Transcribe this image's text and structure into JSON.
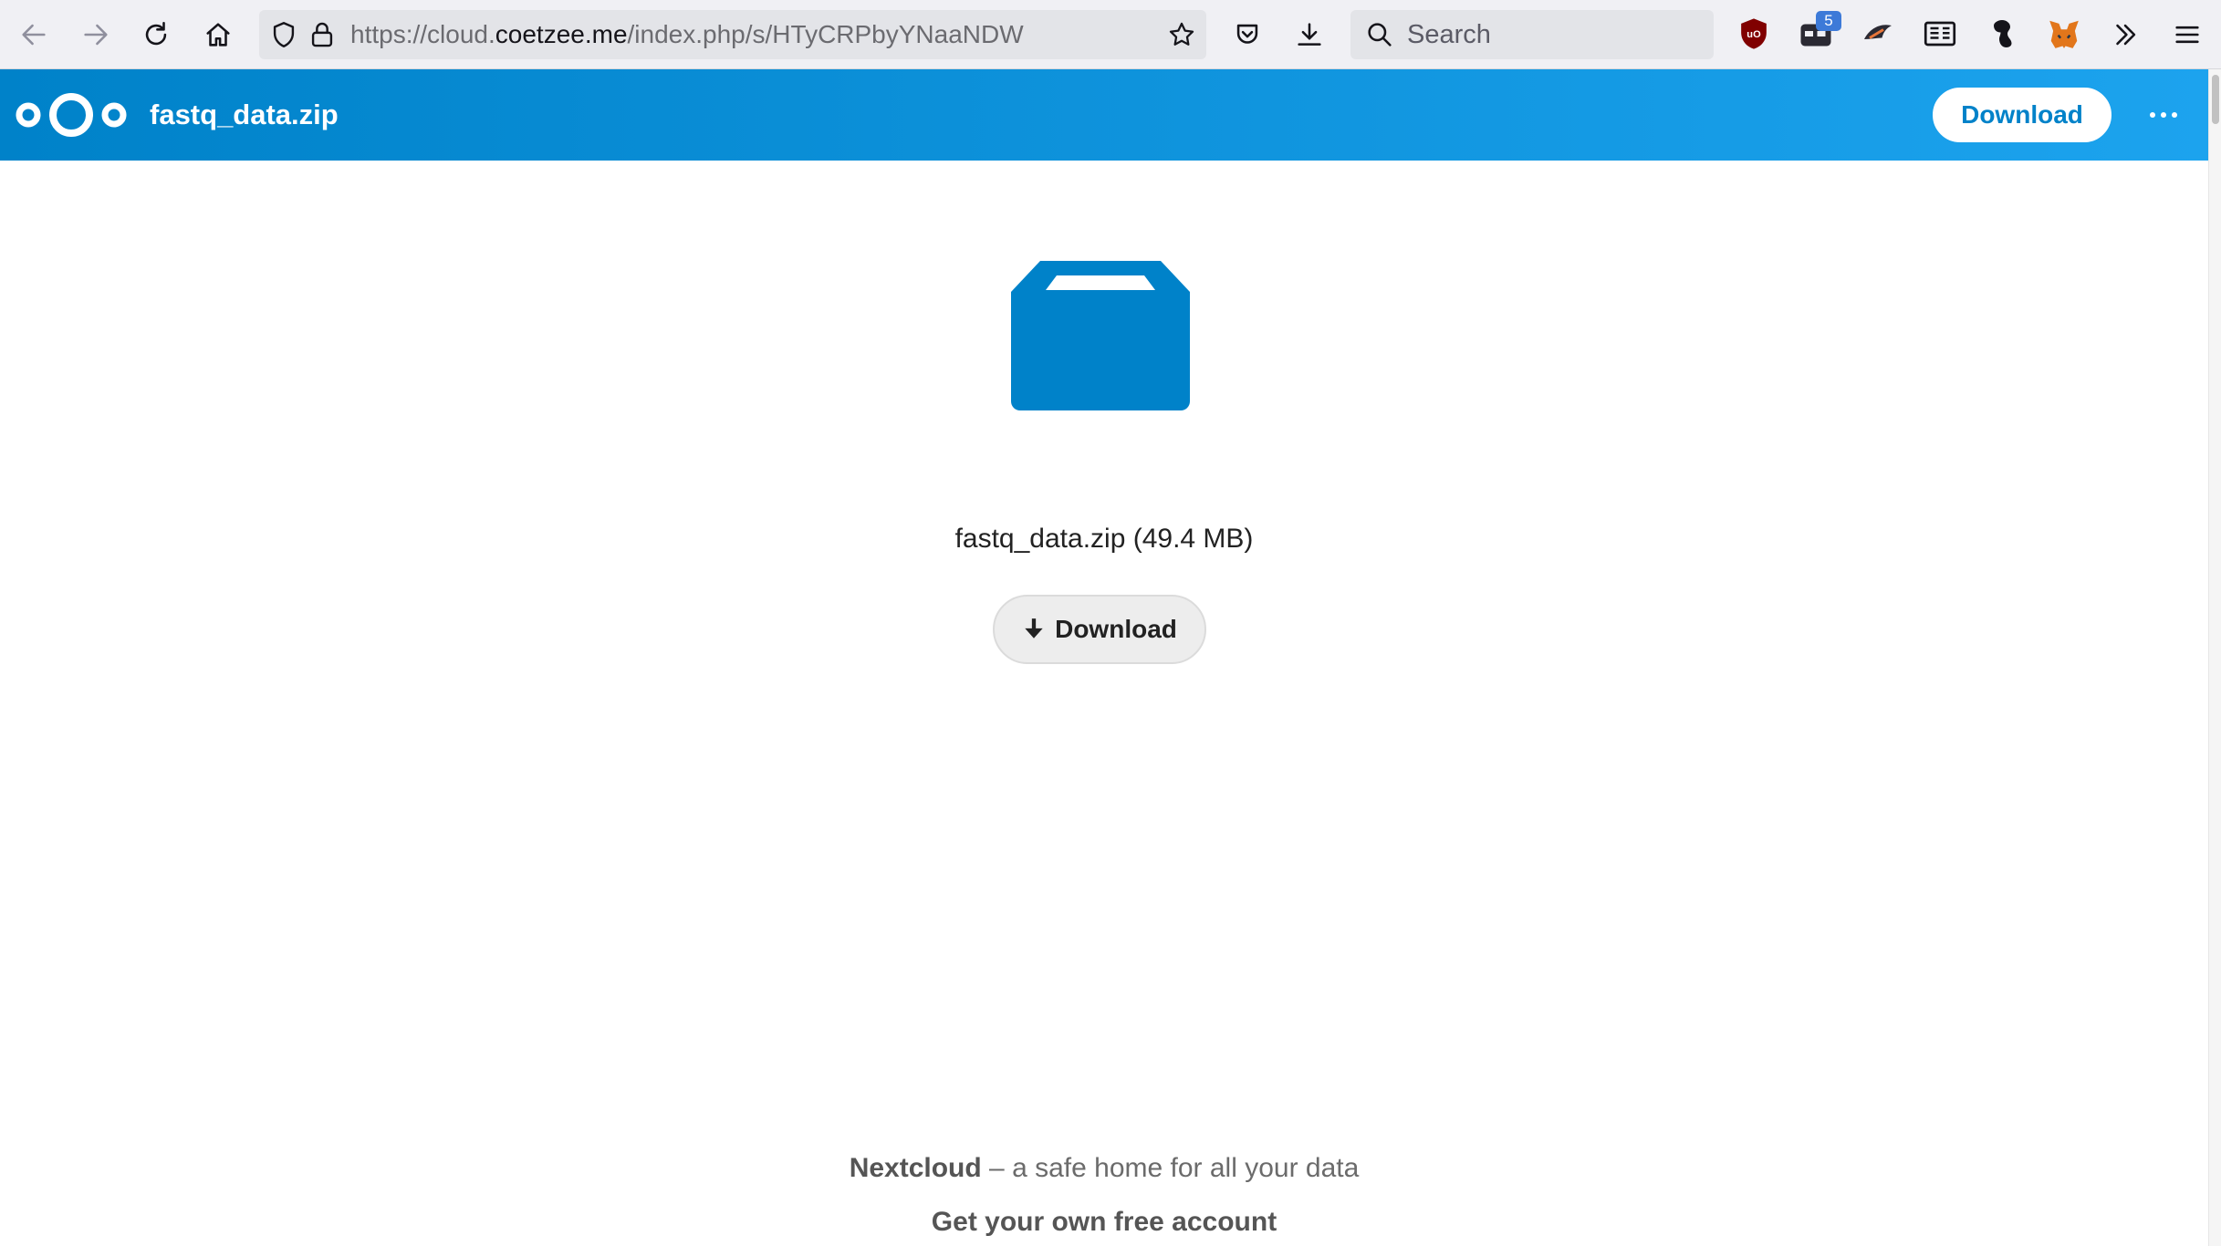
{
  "browser": {
    "url_prefix": "https://cloud.",
    "url_host": "coetzee.me",
    "url_path": "/index.php/s/HTyCRPbyYNaaNDW",
    "search_placeholder": "Search",
    "extension_badge": "5",
    "icons": [
      "back-arrow-icon",
      "forward-arrow-icon",
      "reload-icon",
      "home-icon",
      "shield-icon",
      "lock-icon",
      "bookmark-star-icon",
      "pocket-icon",
      "downloads-icon",
      "search-icon",
      "ublock-icon",
      "extension-icon",
      "extension-icon",
      "reader-icon",
      "extension-icon",
      "metamask-icon",
      "overflow-chevrons-icon",
      "hamburger-menu-icon"
    ]
  },
  "header": {
    "title": "fastq_data.zip",
    "download_label": "Download",
    "brand_color": "#0082c9"
  },
  "file": {
    "info": "fastq_data.zip (49.4 MB)",
    "download_label": "Download",
    "icon": "package-icon",
    "icon_color": "#0082c9"
  },
  "footer": {
    "brand": "Nextcloud",
    "tagline": " – a safe home for all your data",
    "signup": "Get your own free account"
  }
}
